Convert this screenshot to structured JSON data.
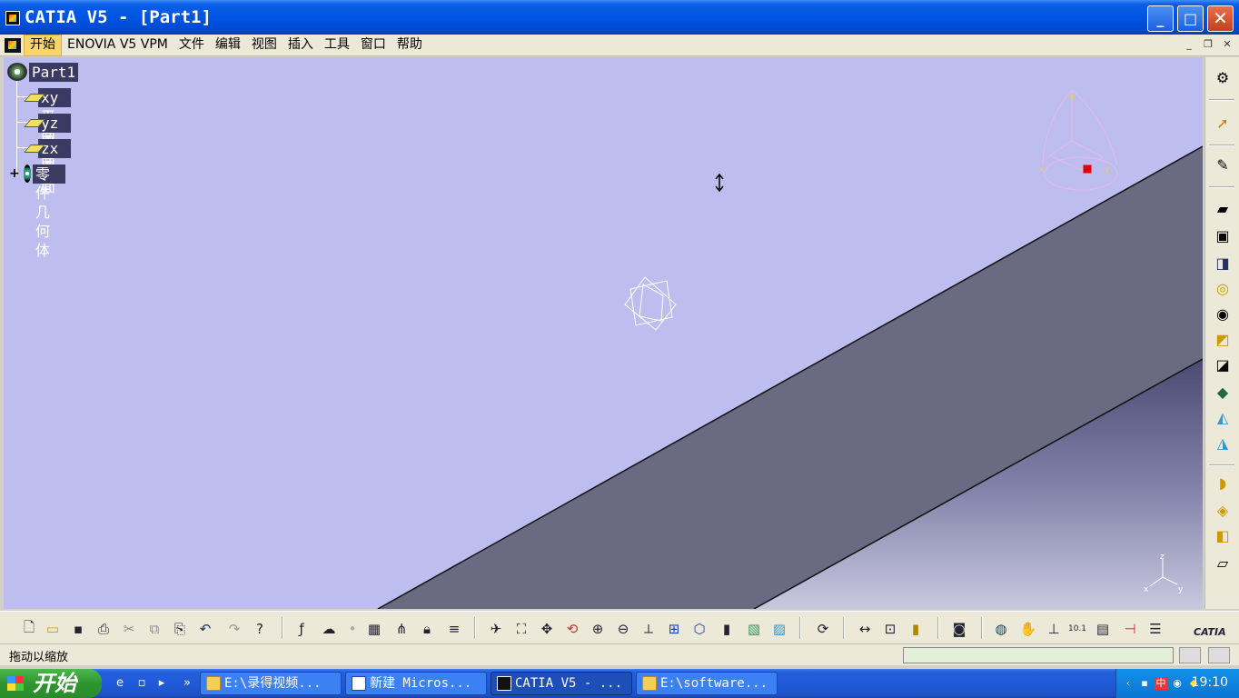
{
  "window": {
    "title": "CATIA V5 - [Part1]",
    "minimize_glyph": "_",
    "maximize_glyph": "□",
    "close_glyph": "✕"
  },
  "menu": {
    "items": [
      "开始",
      "ENOVIA V5 VPM",
      "文件",
      "编辑",
      "视图",
      "插入",
      "工具",
      "窗口",
      "帮助"
    ],
    "doc_min": "_",
    "doc_restore": "❐",
    "doc_close": "✕"
  },
  "tree": {
    "root": "Part1",
    "children": [
      "xy 平面",
      "yz 平面",
      "zx 平面",
      "零件几何体"
    ],
    "expand_glyph": "+"
  },
  "compass": {
    "axis_labels": [
      "z",
      "x",
      "y"
    ]
  },
  "axis_triad": {
    "labels": [
      "z",
      "x",
      "y"
    ]
  },
  "right_toolbar": {
    "icons": [
      "gear-icon",
      "select-arrow-icon",
      "sketcher-icon",
      "pad-icon",
      "pocket-icon",
      "shaft-icon",
      "groove-icon",
      "hole-icon",
      "rib-icon",
      "slot-icon",
      "solid-combine-icon",
      "stiffener-icon",
      "multi-section-icon",
      "fillet-icon",
      "chamfer-icon",
      "draft-icon",
      "shell-icon"
    ]
  },
  "bottom_toolbar": {
    "icons": [
      "new-icon",
      "open-icon",
      "save-icon",
      "print-icon",
      "cut-icon",
      "copy-icon",
      "paste-icon",
      "undo-icon",
      "redo-icon",
      "whats-this-icon",
      "formula-icon",
      "knowledge-advisor-icon",
      "bulb-icon",
      "table-icon",
      "tree-expand-icon",
      "lock-icon",
      "parameters-icon",
      "fly-mode-icon",
      "fit-all-icon",
      "pan-icon",
      "rotate-icon",
      "zoom-in-icon",
      "zoom-out-icon",
      "normal-view-icon",
      "multi-view-icon",
      "iso-view-icon",
      "render-style-icon",
      "hide-show-icon",
      "swap-visible-icon",
      "update-icon",
      "measure-between-icon",
      "measure-item-icon",
      "measure-inertia-icon",
      "capture-icon",
      "catalog-icon",
      "hand-icon",
      "axis-system-icon",
      "units-icon",
      "plane-system-icon",
      "constraint-icon",
      "list-icon"
    ],
    "catia_logo": "CATIA"
  },
  "status": {
    "text": "拖动以缩放",
    "command_input": ""
  },
  "taskbar": {
    "start_label": "开始",
    "chevron": "»",
    "tasks": [
      {
        "label": "E:\\录得视频...",
        "icon": "folder"
      },
      {
        "label": "新建 Micros...",
        "icon": "word"
      },
      {
        "label": "CATIA V5 - ...",
        "icon": "catia",
        "active": true
      },
      {
        "label": "E:\\software...",
        "icon": "folder"
      }
    ],
    "clock": "19:10",
    "ime_label": "中"
  },
  "colors": {
    "viewport_bg": "#bdbdf0",
    "part_face": "#6a6a82",
    "tree_label_bg": "#3a3a62",
    "title_blue": "#0054e3"
  }
}
